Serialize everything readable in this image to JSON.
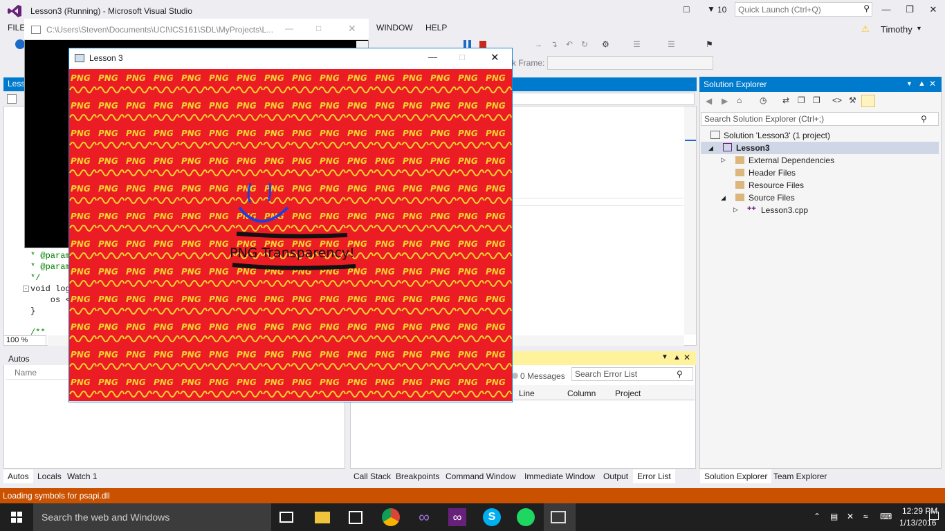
{
  "vs": {
    "title": "Lesson3 (Running) - Microsoft Visual Studio",
    "notification_count": "10",
    "quick_launch_placeholder": "Quick Launch (Ctrl+Q)",
    "user": "Timothy",
    "menu": [
      "FILE",
      "WINDOW",
      "HELP"
    ],
    "stack_frame_label": "k Frame:"
  },
  "console": {
    "title": "C:\\Users\\Steven\\Documents\\UCI\\ICS161\\SDL\\MyProjects\\L..."
  },
  "sdl_window": {
    "title": "Lesson 3",
    "canvas_text": "PNG Transparency!",
    "tile_text": "PNG",
    "colors": {
      "background": "#ec1c24",
      "tile": "#f5d130",
      "smile": "#1f3fd8",
      "ink": "#111111"
    }
  },
  "editor": {
    "tab": "Lesso",
    "zoom": "100 %",
    "code": [
      "* @param",
      "* @param",
      "*/",
      "void log",
      "    os <",
      "}",
      "/**"
    ]
  },
  "autos": {
    "title": "Autos",
    "column_name": "Name",
    "tabs": [
      "Autos",
      "Locals",
      "Watch 1"
    ]
  },
  "error_list": {
    "messages": "0 Messages",
    "search_placeholder": "Search Error List",
    "columns": [
      "Line",
      "Column",
      "Project"
    ],
    "tabs": [
      "Call Stack",
      "Breakpoints",
      "Command Window",
      "Immediate Window",
      "Output",
      "Error List"
    ]
  },
  "solution_explorer": {
    "title": "Solution Explorer",
    "search_placeholder": "Search Solution Explorer (Ctrl+;)",
    "solution": "Solution 'Lesson3' (1 project)",
    "project": "Lesson3",
    "items": [
      "External Dependencies",
      "Header Files",
      "Resource Files",
      "Source Files"
    ],
    "file": "Lesson3.cpp",
    "tabs": [
      "Solution Explorer",
      "Team Explorer"
    ]
  },
  "status": {
    "text": "Loading symbols for psapi.dll"
  },
  "taskbar": {
    "search_text": "Search the web and Windows",
    "time": "12:29 PM",
    "date": "1/13/2016"
  }
}
